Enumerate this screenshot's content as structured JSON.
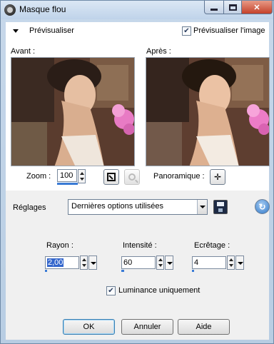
{
  "window": {
    "title": "Masque flou"
  },
  "preview": {
    "header": "Prévisualiser",
    "checkbox_label": "Prévisualiser l'image",
    "checkbox_checked": true,
    "before_label": "Avant :",
    "after_label": "Après :",
    "zoom_label": "Zoom :",
    "zoom_value": "100",
    "pan_label": "Panoramique :"
  },
  "settings": {
    "label": "Réglages",
    "selected": "Dernières options utilisées"
  },
  "params": {
    "radius_label": "Rayon :",
    "radius_value": "2,00",
    "intensity_label": "Intensité :",
    "intensity_value": "60",
    "clip_label": "Ecrêtage :",
    "clip_value": "4",
    "luminance_label": "Luminance uniquement",
    "luminance_checked": true
  },
  "buttons": {
    "ok": "OK",
    "cancel": "Annuler",
    "help": "Aide"
  },
  "icons": {
    "app": "camera-icon",
    "collapse": "triangle-down-icon",
    "fit": "fit-window-icon",
    "magnify": "magnifier-icon",
    "pan": "move-cross-icon",
    "save": "floppy-disk-icon",
    "reset": "reset-arrow-icon"
  },
  "colors": {
    "close_button": "#c4412a",
    "accent": "#3a7bd5"
  }
}
